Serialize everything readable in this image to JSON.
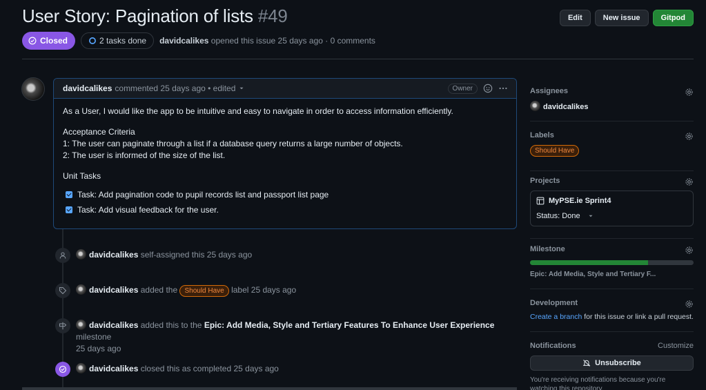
{
  "issue": {
    "title": "User Story: Pagination of lists",
    "number": "#49",
    "state": "Closed",
    "tasks": "2 tasks done",
    "author": "davidcalikes",
    "meta": "opened this issue 25 days ago · 0 comments"
  },
  "header_buttons": {
    "edit": "Edit",
    "new_issue": "New issue",
    "gitpod": "Gitpod"
  },
  "comment": {
    "author": "davidcalikes",
    "meta": "commented 25 days ago • edited",
    "owner_badge": "Owner",
    "intro": "As a User, I would like the app to be intuitive and easy to navigate in order to access information efficiently.",
    "ac_title": "Acceptance Criteria",
    "ac_1": "1: The user can paginate through a list if a database query returns a large number of objects.",
    "ac_2": "2: The user is informed of the size of the list.",
    "unit_tasks": "Unit Tasks",
    "tasks": [
      {
        "label": "Task: Add pagination code to pupil records list and passport list page",
        "checked": true
      },
      {
        "label": "Task: Add visual feedback for the user.",
        "checked": true
      }
    ]
  },
  "timeline": [
    {
      "actor": "davidcalikes",
      "text": "self-assigned this 25 days ago"
    },
    {
      "actor": "davidcalikes",
      "pre": "added the",
      "label": "Should Have",
      "post": "label 25 days ago"
    },
    {
      "actor": "davidcalikes",
      "pre": "added this to the",
      "milestone": "Epic: Add Media, Style and Tertiary Features To Enhance User Experience",
      "post": "milestone",
      "time": "25 days ago"
    },
    {
      "actor": "davidcalikes",
      "text": "closed this as completed 25 days ago"
    }
  ],
  "sidebar": {
    "assignees": {
      "title": "Assignees",
      "value": "davidcalikes"
    },
    "labels": {
      "title": "Labels",
      "value": "Should Have"
    },
    "projects": {
      "title": "Projects",
      "project": "MyPSE.ie Sprint4",
      "status": "Status: Done"
    },
    "milestone": {
      "title": "Milestone",
      "value": "Epic: Add Media, Style and Tertiary F...",
      "progress": 0.72
    },
    "development": {
      "title": "Development",
      "link": "Create a branch",
      "text": "for this issue or link a pull request."
    },
    "notifications": {
      "title": "Notifications",
      "customize": "Customize",
      "button": "Unsubscribe",
      "note": "You're receiving notifications because you're watching this repository."
    }
  },
  "colors": {
    "closed": "#8957e5",
    "accent_link": "#58a6ff",
    "green": "#238636",
    "label_orange": "#f0883e"
  }
}
